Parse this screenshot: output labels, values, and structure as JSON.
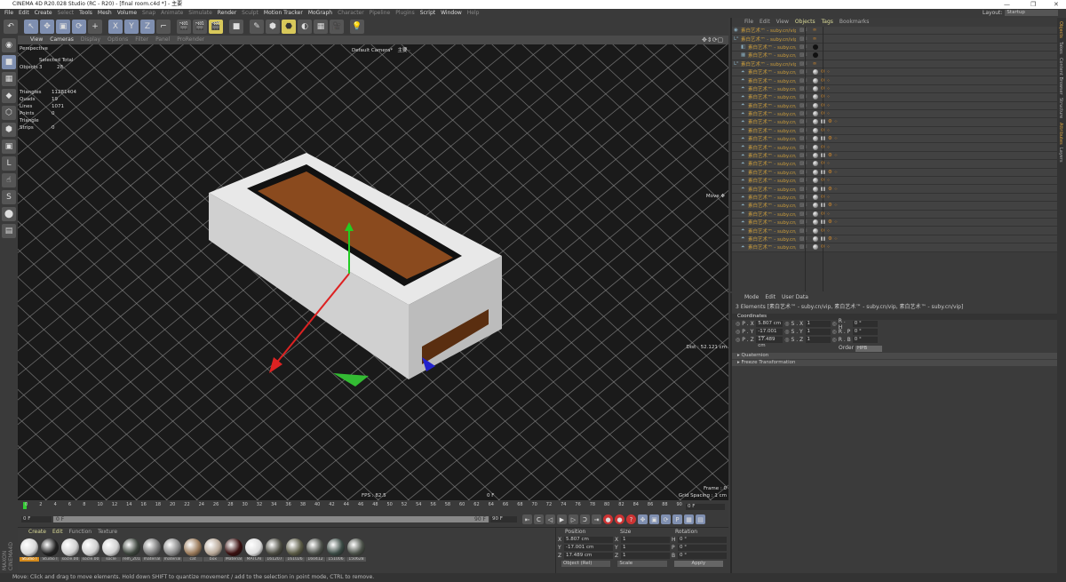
{
  "window": {
    "title": "CINEMA 4D R20.028 Studio (RC - R20) - [final room.c4d *] - 主要",
    "minimize": "—",
    "restore": "❐",
    "close": "✕"
  },
  "menu": [
    "File",
    "Edit",
    "Create",
    "Select",
    "Tools",
    "Mesh",
    "Volume",
    "Snap",
    "Animate",
    "Simulate",
    "Render",
    "Sculpt",
    "Motion Tracker",
    "MoGraph",
    "Character",
    "Pipeline",
    "Plugins",
    "Script",
    "Window",
    "Help"
  ],
  "layout": {
    "label": "Layout:",
    "value": "Startup"
  },
  "toolbar": {
    "icons": [
      "undo-icon",
      "live-selection-icon",
      "move-icon",
      "scale-icon",
      "rotate-icon",
      "last-tool-icon",
      "x-axis-icon",
      "y-axis-icon",
      "z-axis-icon",
      "world-coords-icon",
      "render-view-icon",
      "render-picture-viewer-icon",
      "edit-render-settings-icon",
      "cube-icon",
      "pen-icon",
      "subdivision-icon",
      "array-icon",
      "deformer-icon",
      "floor-icon",
      "camera-icon",
      "light-icon"
    ],
    "axis_labels": [
      "X",
      "Y",
      "Z"
    ]
  },
  "viewport": {
    "menu": [
      "View",
      "Cameras",
      "Display",
      "Options",
      "Filter",
      "Panel",
      "ProRender"
    ],
    "projection": "Perspective",
    "camera": "Default Camera*",
    "camera_suffix": "主要 ·",
    "stats": {
      "header": [
        "Selected",
        "Total"
      ],
      "objects": {
        "label": "Objects",
        "selected": "3",
        "total": "28"
      },
      "rows": [
        {
          "label": "Triangles",
          "value": "11281404"
        },
        {
          "label": "Quads",
          "value": "19"
        },
        {
          "label": "Lines",
          "value": "1071"
        },
        {
          "label": "Points",
          "value": "0"
        },
        {
          "label": "Triangle Strips",
          "value": "0"
        }
      ]
    },
    "tool_label": "Move ✥",
    "dist": "Dist : 52.121 cm",
    "fps": "FPS : 82.5",
    "frame_center": "0 F",
    "frame": "Frame : 0",
    "grid_spacing": "Grid Spacing : 1 cm"
  },
  "timeline": {
    "ticks": [
      0,
      2,
      4,
      6,
      8,
      10,
      12,
      14,
      16,
      18,
      20,
      22,
      24,
      26,
      28,
      30,
      32,
      34,
      36,
      38,
      40,
      42,
      44,
      46,
      48,
      50,
      52,
      54,
      56,
      58,
      60,
      62,
      64,
      66,
      68,
      70,
      72,
      74,
      76,
      78,
      80,
      82,
      84,
      86,
      88,
      90
    ],
    "current_frame": "0 F",
    "start": "0 F",
    "end_field": "90 F",
    "range_end": "90 F",
    "slider_label": "0 F",
    "range_max": "90 F"
  },
  "playback": {
    "icons": [
      "go-start-icon",
      "prev-key-icon",
      "prev-frame-icon",
      "play-icon",
      "next-frame-icon",
      "next-key-icon",
      "go-end-icon",
      "record-icon",
      "autokey-icon",
      "keyframe-selection-icon",
      "move-key-icon",
      "scale-key-icon",
      "rotate-key-icon",
      "param-key-icon",
      "pla-key-icon",
      "timeline-icon"
    ]
  },
  "materials": {
    "menu": [
      "Create",
      "Edit",
      "Function",
      "Texture"
    ],
    "items": [
      {
        "name": "Studio I",
        "color": "#d8d8d8"
      },
      {
        "name": "Studio I",
        "color": "#222"
      },
      {
        "name": "socle.00",
        "color": "#cfcfcf"
      },
      {
        "name": "socle.00",
        "color": "#cfcfcf"
      },
      {
        "name": "socle",
        "color": "#d0d0d0"
      },
      {
        "name": "relh_201",
        "color": "#3c443c"
      },
      {
        "name": "material",
        "color": "#777"
      },
      {
        "name": "material",
        "color": "#888"
      },
      {
        "name": "cat",
        "color": "#9a7a5a"
      },
      {
        "name": "box",
        "color": "#b8a898"
      },
      {
        "name": "Material",
        "color": "#3a1010"
      },
      {
        "name": "MATCAI",
        "color": "#ddd"
      },
      {
        "name": "161207",
        "color": "#4a4a40"
      },
      {
        "name": "161026",
        "color": "#5a5a45"
      },
      {
        "name": "160412",
        "color": "#4a4e48"
      },
      {
        "name": "151006",
        "color": "#3a4a44"
      },
      {
        "name": "150628",
        "color": "#4a5048"
      }
    ]
  },
  "coords": {
    "headers": [
      "Position",
      "Size",
      "Rotation"
    ],
    "rows": [
      {
        "axis": "X",
        "pos": "5.807 cm",
        "size_axis": "X",
        "size": "1",
        "rot_axis": "H",
        "rot": "0 °"
      },
      {
        "axis": "Y",
        "pos": "-17.001 cm",
        "size_axis": "Y",
        "size": "1",
        "rot_axis": "P",
        "rot": "0 °"
      },
      {
        "axis": "Z",
        "pos": "17.489 cm",
        "size_axis": "Z",
        "size": "1",
        "rot_axis": "B",
        "rot": "0 °"
      }
    ],
    "mode": "Object (Rel)",
    "size_mode": "Scale",
    "apply": "Apply"
  },
  "status": "Move: Click and drag to move elements. Hold down SHIFT to quantize movement / add to the selection in point mode, CTRL to remove.",
  "objects": {
    "menu": [
      "File",
      "Edit",
      "View",
      "Objects",
      "Tags",
      "Bookmarks"
    ],
    "rows": [
      {
        "name": "素白艺术™ - suby.cn/vip",
        "icon": "null-icon"
      },
      {
        "name": "素白艺术™ - suby.cn/vip",
        "icon": "group-icon"
      },
      {
        "name": "素白艺术™ - suby.cn/vip",
        "icon": "sky-icon"
      },
      {
        "name": "素白艺术™ - suby.cn/vip",
        "icon": "floor-icon"
      },
      {
        "name": "素白艺术™ - suby.cn/vip",
        "icon": "group-icon"
      },
      {
        "name": "素白艺术™ - suby.cn/vip",
        "icon": "polygon-icon"
      },
      {
        "name": "素白艺术™ - suby.cn/vip",
        "icon": "polygon-icon"
      },
      {
        "name": "素白艺术™ - suby.cn/vip",
        "icon": "polygon-icon"
      },
      {
        "name": "素白艺术™ - suby.cn/vip",
        "icon": "polygon-icon"
      },
      {
        "name": "素白艺术™ - suby.cn/vip",
        "icon": "polygon-icon"
      },
      {
        "name": "素白艺术™ - suby.cn/vip",
        "icon": "polygon-icon"
      },
      {
        "name": "素白艺术™ - suby.cn/vip",
        "icon": "polygon-icon"
      },
      {
        "name": "素白艺术™ - suby.cn/vip",
        "icon": "polygon-icon"
      },
      {
        "name": "素白艺术™ - suby.cn/vip",
        "icon": "polygon-icon"
      },
      {
        "name": "素白艺术™ - suby.cn/vip",
        "icon": "polygon-icon"
      },
      {
        "name": "素白艺术™ - suby.cn/vip",
        "icon": "polygon-icon"
      },
      {
        "name": "素白艺术™ - suby.cn/vip",
        "icon": "polygon-icon"
      },
      {
        "name": "素白艺术™ - suby.cn/vip",
        "icon": "polygon-icon"
      },
      {
        "name": "素白艺术™ - suby.cn/vip",
        "icon": "polygon-icon"
      },
      {
        "name": "素白艺术™ - suby.cn/vip",
        "icon": "polygon-icon"
      },
      {
        "name": "素白艺术™ - suby.cn/vip",
        "icon": "polygon-icon"
      },
      {
        "name": "素白艺术™ - suby.cn/vip",
        "icon": "polygon-icon"
      },
      {
        "name": "素白艺术™ - suby.cn/vip",
        "icon": "polygon-icon"
      },
      {
        "name": "素白艺术™ - suby.cn/vip",
        "icon": "polygon-icon"
      },
      {
        "name": "素白艺术™ - suby.cn/vip",
        "icon": "polygon-icon"
      },
      {
        "name": "素白艺术™ - suby.cn/vip",
        "icon": "polygon-icon"
      },
      {
        "name": "素白艺术™ - suby.cn/vip",
        "icon": "polygon-icon"
      }
    ]
  },
  "attributes": {
    "menu": [
      "Mode",
      "Edit",
      "User Data"
    ],
    "title": "3 Elements [素白艺术™ - suby.cn/vip, 素白艺术™ - suby.cn/vip, 素白艺术™ - suby.cn/vip]",
    "section": "Coordinates",
    "rows": [
      {
        "p": "P . X",
        "pv": "5.807 cm",
        "s": "S . X",
        "sv": "1",
        "r": "R . H",
        "rv": "0 °"
      },
      {
        "p": "P . Y",
        "pv": "-17.001 cm",
        "s": "S . Y",
        "sv": "1",
        "r": "R . P",
        "rv": "0 °"
      },
      {
        "p": "P . Z",
        "pv": "17.489 cm",
        "s": "S . Z",
        "sv": "1",
        "r": "R . B",
        "rv": "0 °"
      }
    ],
    "order_label": "Order",
    "order": "HPB",
    "collapsed": [
      "Quaternion",
      "Freeze Transformation"
    ]
  },
  "right_tabs": [
    "Objects",
    "Takes",
    "Content Browser",
    "Structure",
    "Attributes",
    "Layers"
  ],
  "colors": {
    "accent": "#c89a3a",
    "viewport_bg": "#1a1a1a",
    "grid": "#8a8a8a",
    "wood": "#8a4a1e"
  }
}
